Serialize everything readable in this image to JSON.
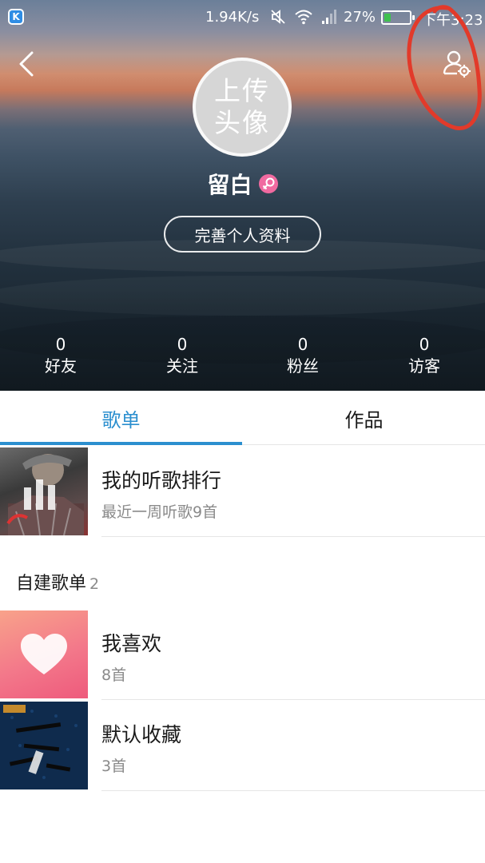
{
  "status_bar": {
    "app_badge": "K",
    "net_speed": "1.94K/s",
    "battery_percent": "27%",
    "battery_level": 0.27,
    "time": "下午3:23",
    "icons": [
      "mute-icon",
      "wifi-icon",
      "signal-icon",
      "battery-icon"
    ]
  },
  "header": {
    "back_icon": "chevron-left-icon",
    "settings_icon": "user-settings-icon",
    "avatar_text": "上传头像",
    "username": "留白",
    "gender": "female",
    "edit_profile_label": "完善个人资料",
    "annotation_color": "#e23a2a"
  },
  "stats": [
    {
      "value": "0",
      "label": "好友"
    },
    {
      "value": "0",
      "label": "关注"
    },
    {
      "value": "0",
      "label": "粉丝"
    },
    {
      "value": "0",
      "label": "访客"
    }
  ],
  "tabs": [
    {
      "label": "歌单",
      "active": true
    },
    {
      "label": "作品",
      "active": false
    }
  ],
  "ranking": {
    "title": "我的听歌排行",
    "subtitle": "最近一周听歌9首"
  },
  "self_playlists": {
    "header": "自建歌单",
    "count": "2",
    "items": [
      {
        "title": "我喜欢",
        "subtitle": "8首"
      },
      {
        "title": "默认收藏",
        "subtitle": "3首"
      }
    ]
  },
  "colors": {
    "accent": "#2b8fcf",
    "female": "#f06aa0",
    "heart_cover": "#f3788a"
  }
}
